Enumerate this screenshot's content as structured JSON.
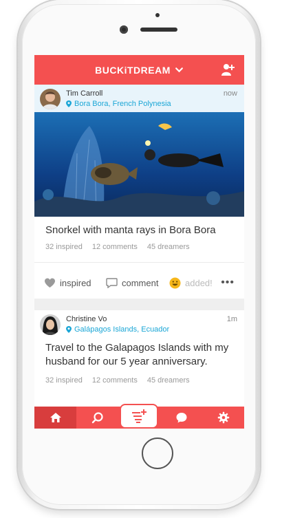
{
  "header": {
    "brand": "BUCKiTDREAM"
  },
  "posts": [
    {
      "user": "Tim Carroll",
      "location": "Bora Bora, French Polynesia",
      "time": "now",
      "title": "Snorkel with manta rays in Bora Bora",
      "stats": [
        "32 inspired",
        "12 comments",
        "45 dreamers"
      ],
      "actions": {
        "inspired": "inspired",
        "comment": "comment",
        "added": "added!",
        "more": "•••"
      }
    },
    {
      "user": "Christine Vo",
      "location": "Galápagos Islands, Ecuador",
      "time": "1m",
      "title": "Travel to the Galapagos Islands with my husband for our 5 year anniversary.",
      "stats": [
        "32 inspired",
        "12 comments",
        "45 dreamers"
      ]
    }
  ],
  "colors": {
    "brand_red": "#f45050",
    "link_blue": "#1aa6d6",
    "accent_yellow": "#f6b619"
  },
  "tabs": [
    "home-icon",
    "search-icon",
    "add-list-icon",
    "chat-icon",
    "gear-icon"
  ]
}
